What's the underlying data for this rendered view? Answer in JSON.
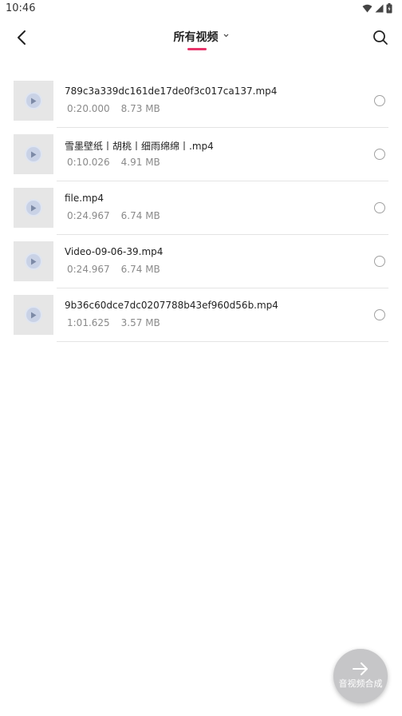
{
  "status_bar": {
    "time": "10:46",
    "icons": [
      "wifi-icon",
      "signal-icon",
      "battery-icon"
    ]
  },
  "header": {
    "title": "所有视频",
    "back_icon": "back-arrow-icon",
    "dropdown_icon": "chevron-down-icon",
    "search_icon": "search-icon",
    "accent_color": "#e8336a"
  },
  "videos": [
    {
      "name": "789c3a339dc161de17de0f3c017ca137.mp4",
      "duration": "0:20.000",
      "size": "8.73 MB"
    },
    {
      "name": "雪墨壁纸丨胡桃丨细雨绵绵丨.mp4",
      "duration": "0:10.026",
      "size": "4.91 MB"
    },
    {
      "name": "file.mp4",
      "duration": "0:24.967",
      "size": "6.74 MB"
    },
    {
      "name": "Video-09-06-39.mp4",
      "duration": "0:24.967",
      "size": "6.74 MB"
    },
    {
      "name": "9b36c60dce7dc0207788b43ef960d56b.mp4",
      "duration": "1:01.625",
      "size": "3.57 MB"
    }
  ],
  "fab": {
    "label": "音视频合成",
    "icon": "arrow-right-icon"
  }
}
